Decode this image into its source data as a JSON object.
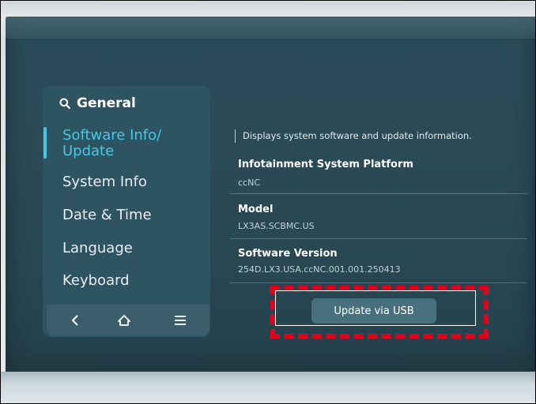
{
  "sidebar": {
    "header": "General",
    "items": [
      {
        "label_line1": "Software Info/",
        "label_line2": "Update",
        "active": true
      },
      {
        "label": "System Info"
      },
      {
        "label": "Date & Time"
      },
      {
        "label": "Language"
      },
      {
        "label": "Keyboard"
      }
    ],
    "bottom_bar": [
      "back-icon",
      "home-icon",
      "menu-icon"
    ]
  },
  "content": {
    "description": "Displays system software and update information.",
    "rows": [
      {
        "title": "Infotainment System Platform",
        "value": "ccNC"
      },
      {
        "title": "Model",
        "value": "LX3AS.SCBMC.US"
      },
      {
        "title": "Software Version",
        "value": "254D.LX3.USA.ccNC.001.001.250413"
      }
    ],
    "update_button": "Update via USB"
  },
  "colors": {
    "accent": "#45c8e6",
    "screen": "#2a4c58",
    "highlight": "#e3001b"
  }
}
